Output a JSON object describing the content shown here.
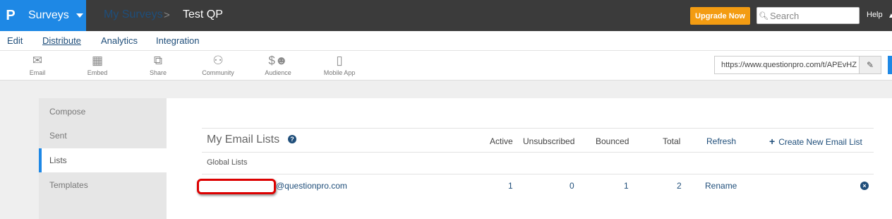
{
  "topbar": {
    "logo": "P",
    "product": "Surveys",
    "breadcrumb_parent": "My Surveys",
    "breadcrumb_sep": ">",
    "breadcrumb_current": "Test QP",
    "upgrade_label": "Upgrade Now",
    "search_placeholder": "Search",
    "help_label": "Help",
    "colors": {
      "brand": "#1e88e5",
      "bar": "#3b3b3b",
      "upgrade": "#f39c12"
    }
  },
  "subnav": {
    "items": [
      "Edit",
      "Distribute",
      "Analytics",
      "Integration"
    ],
    "active": "Distribute"
  },
  "toolbar": {
    "tools": [
      {
        "label": "Email",
        "icon": "envelope-icon"
      },
      {
        "label": "Embed",
        "icon": "embed-icon"
      },
      {
        "label": "Share",
        "icon": "share-icon"
      },
      {
        "label": "Community",
        "icon": "community-icon"
      },
      {
        "label": "Audience",
        "icon": "audience-icon"
      },
      {
        "label": "Mobile App",
        "icon": "mobile-icon"
      }
    ],
    "url": "https://www.questionpro.com/t/APEvHZ"
  },
  "leftnav": {
    "items": [
      "Compose",
      "Sent",
      "Lists",
      "Templates"
    ],
    "selected": "Lists"
  },
  "main": {
    "title": "My Email Lists",
    "columns": {
      "active": "Active",
      "unsubscribed": "Unsubscribed",
      "bounced": "Bounced",
      "total": "Total",
      "refresh": "Refresh"
    },
    "create_label": "Create New Email List",
    "section": "Global Lists",
    "rows": [
      {
        "name": "@questionpro.com",
        "active": "1",
        "unsubscribed": "0",
        "bounced": "1",
        "total": "2",
        "action": "Rename"
      }
    ]
  }
}
